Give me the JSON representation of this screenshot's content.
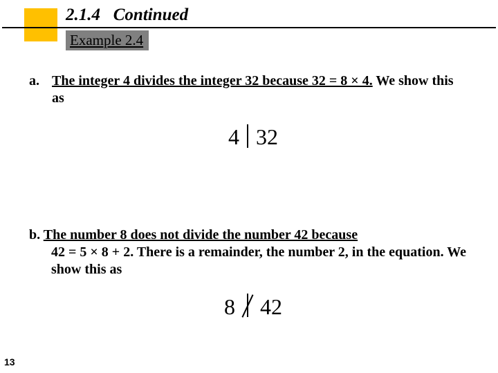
{
  "header": {
    "section_number": "2.1.4",
    "section_word": "Continued",
    "example_label": "Example 2.4"
  },
  "item_a": {
    "label": "a.",
    "underlined": "The integer 4 divides the integer 32 because 32 = 8 × 4.",
    "trailing": " We show this as",
    "math_left": "4",
    "math_right": "32"
  },
  "item_b": {
    "line1_label": "b. ",
    "line1_underlined": "The number 8 does not divide the number 42 because",
    "line2_underlined_part": "42 = 5 × 8 + 2.",
    "line2_rest": " There is a remainder, the number 2, in the equation. We show this as",
    "math_left": "8",
    "math_right": "42"
  },
  "page_number": "13"
}
